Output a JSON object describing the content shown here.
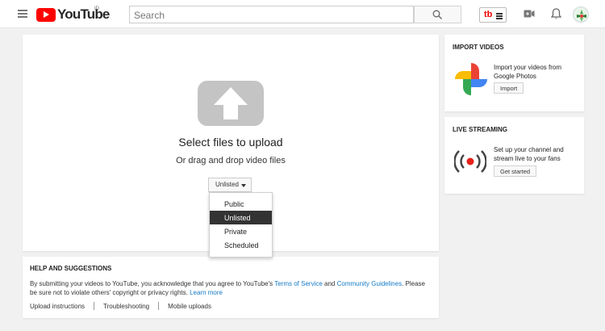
{
  "header": {
    "logo_text": "YouTube",
    "country_code": "ID",
    "search_placeholder": "Search",
    "tube_label": "tb"
  },
  "upload": {
    "title": "Select files to upload",
    "subtitle": "Or drag and drop video files",
    "privacy_selected": "Unlisted",
    "privacy_options": [
      "Public",
      "Unlisted",
      "Private",
      "Scheduled"
    ]
  },
  "help": {
    "title": "HELP AND SUGGESTIONS",
    "text_before_tos": "By submitting your videos to YouTube, you acknowledge that you agree to YouTube's ",
    "tos_link": "Terms of Service",
    "text_and": " and ",
    "guidelines_link": "Community Guidelines",
    "text_after": ". Please be sure not to violate others' copyright or privacy rights. ",
    "learn_more": "Learn more",
    "links": [
      "Upload instructions",
      "Troubleshooting",
      "Mobile uploads"
    ]
  },
  "import": {
    "title": "IMPORT VIDEOS",
    "text": "Import your videos from Google Photos",
    "button": "Import"
  },
  "live": {
    "title": "LIVE STREAMING",
    "text": "Set up your channel and stream live to your fans",
    "button": "Get started"
  },
  "colors": {
    "brand_red": "#ff0000",
    "link_blue": "#167ac6",
    "selected_bg": "#333333"
  },
  "icons": [
    "menu-icon",
    "youtube-logo",
    "search-icon",
    "video-camera-icon",
    "bell-icon",
    "upload-arrow-icon",
    "google-photos-icon",
    "live-broadcast-icon"
  ]
}
